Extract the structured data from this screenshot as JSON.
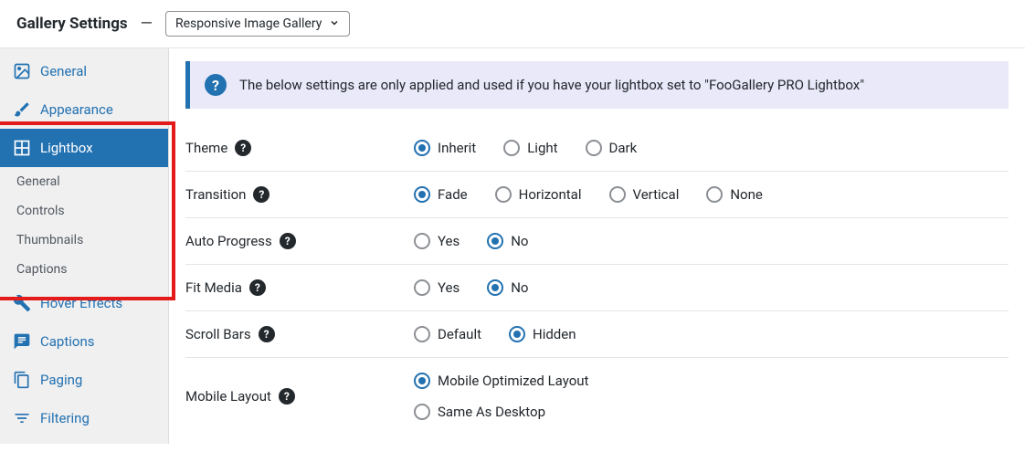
{
  "header": {
    "title": "Gallery Settings",
    "dash": "—",
    "template_selected": "Responsive Image Gallery"
  },
  "sidebar": {
    "items": [
      {
        "label": "General"
      },
      {
        "label": "Appearance"
      },
      {
        "label": "Lightbox"
      },
      {
        "label": "Hover Effects"
      },
      {
        "label": "Captions"
      },
      {
        "label": "Paging"
      },
      {
        "label": "Filtering"
      }
    ],
    "subs": [
      {
        "label": "General"
      },
      {
        "label": "Controls"
      },
      {
        "label": "Thumbnails"
      },
      {
        "label": "Captions"
      }
    ]
  },
  "banner": {
    "text": "The below settings are only applied and used if you have your lightbox set to \"FooGallery PRO Lightbox\""
  },
  "settings": {
    "theme": {
      "label": "Theme",
      "options": [
        "Inherit",
        "Light",
        "Dark"
      ],
      "selected": "Inherit"
    },
    "transition": {
      "label": "Transition",
      "options": [
        "Fade",
        "Horizontal",
        "Vertical",
        "None"
      ],
      "selected": "Fade"
    },
    "auto_progress": {
      "label": "Auto Progress",
      "options": [
        "Yes",
        "No"
      ],
      "selected": "No"
    },
    "fit_media": {
      "label": "Fit Media",
      "options": [
        "Yes",
        "No"
      ],
      "selected": "No"
    },
    "scroll_bars": {
      "label": "Scroll Bars",
      "options": [
        "Default",
        "Hidden"
      ],
      "selected": "Hidden"
    },
    "mobile_layout": {
      "label": "Mobile Layout",
      "options": [
        "Mobile Optimized Layout",
        "Same As Desktop"
      ],
      "selected": "Mobile Optimized Layout"
    }
  }
}
